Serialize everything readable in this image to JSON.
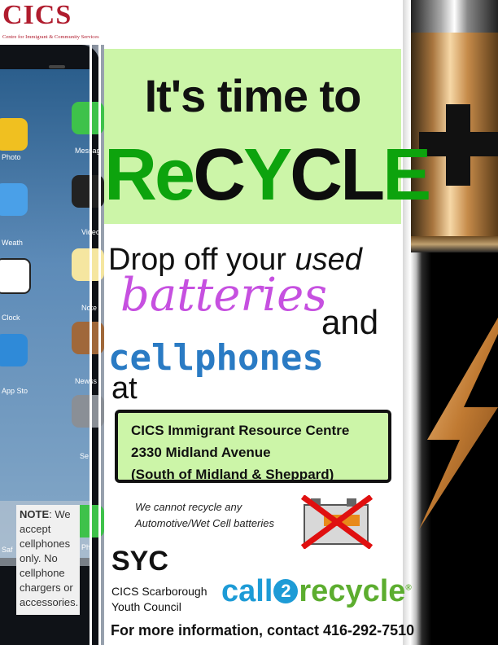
{
  "logo": {
    "acronym": "CICS",
    "full_name": "Centre for Immigrant & Community Services"
  },
  "phone_labels": [
    "Photo",
    "Weath",
    "Clock",
    "App Sto",
    "Messag",
    "Video",
    "Note",
    "Newss",
    "Se",
    "Ph",
    "Saf"
  ],
  "headline": {
    "line1": "It's time to",
    "line2_parts": [
      "Re",
      "C",
      "Y",
      "C",
      "L",
      "E"
    ]
  },
  "message": {
    "drop": "Drop off your",
    "used": "used",
    "batteries": "batteries",
    "and": "and",
    "cellphones": "cellphones",
    "at": "at"
  },
  "address": {
    "line1": "CICS Immigrant Resource Centre",
    "line2": "2330 Midland Avenue",
    "line3": "(South of Midland & Sheppard)"
  },
  "notice": {
    "line1": "We cannot recycle any",
    "line2": "Automotive/Wet Cell batteries"
  },
  "note": {
    "label": "NOTE",
    "text": ": We accept cellphones only. No cellphone chargers or accessories."
  },
  "syc": {
    "title": "SYC",
    "line1": "CICS Scarborough",
    "line2": "Youth Council"
  },
  "call2recycle": {
    "call": "call",
    "two": "2",
    "recycle": "recycle",
    "reg": "®"
  },
  "contact": "For more information, contact 416-292-7510",
  "colors": {
    "green": "#0da30d",
    "light_green": "#ccf5a8",
    "purple": "#c650e0",
    "blue": "#2a7bc4",
    "logo_red": "#b01c2e"
  }
}
